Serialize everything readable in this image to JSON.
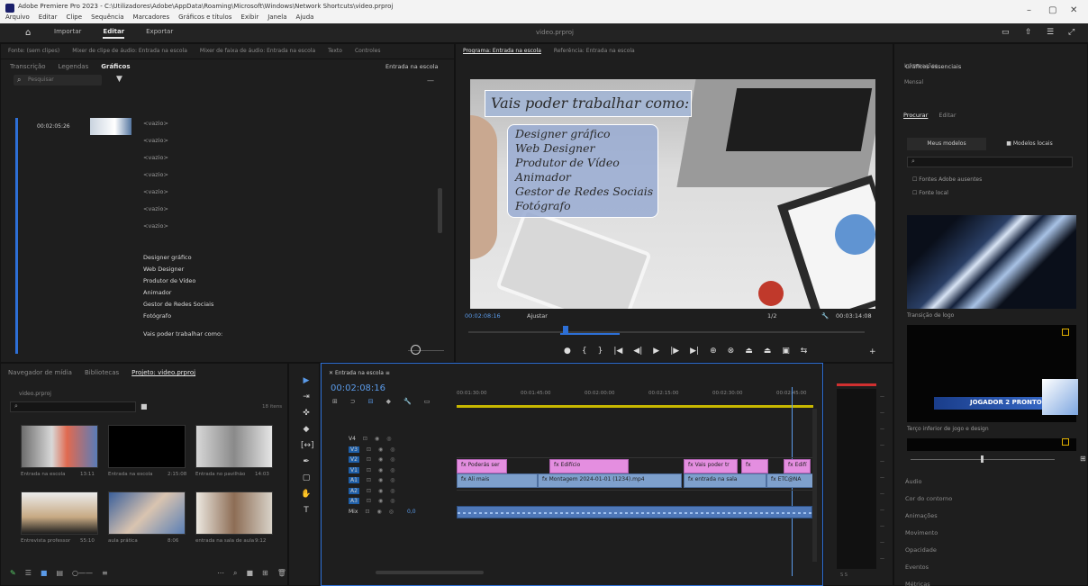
{
  "app": {
    "window_title": "Adobe Premiere Pro 2023 - C:\\Utilizadores\\Adobe\\AppData\\Roaming\\Microsoft\\Windows\\Network Shortcuts\\video.prproj",
    "menu": [
      "Arquivo",
      "Editar",
      "Clipe",
      "Sequência",
      "Marcadores",
      "Gráficos e títulos",
      "Exibir",
      "Janela",
      "Ajuda"
    ],
    "workspace_tabs": [
      "Importar",
      "Editar",
      "Exportar"
    ],
    "active_workspace": "Editar",
    "project_title": "video.prproj"
  },
  "top_left_panel": {
    "header_tabs": [
      "Fonte: (sem clipes)",
      "Mixer de clipe de áudio: Entrada na escola",
      "Mixer de faixa de áudio: Entrada na escola",
      "Texto",
      "Controles"
    ],
    "sub_tabs": [
      "Transcrição",
      "Legendas",
      "Gráficos"
    ],
    "active_sub_tab": "Gráficos",
    "sequence_label": "Entrada na escola",
    "search_placeholder": "Pesquisar",
    "timestamp": "00:02:05:26",
    "blank_items": [
      "<vazio>",
      "<vazio>",
      "<vazio>",
      "<vazio>",
      "<vazio>",
      "<vazio>",
      "<vazio>"
    ],
    "text_layers": [
      "Designer gráfico",
      "Web Designer",
      "Produtor de Vídeo",
      "Animador",
      "Gestor de Redes Sociais",
      "Fotógrafo"
    ],
    "main_layer": "Vais poder trabalhar como:"
  },
  "program_monitor": {
    "header_tabs": [
      "Programa: Entrada na escola",
      "Referência: Entrada na escola"
    ],
    "heading_text": "Vais poder trabalhar como:",
    "list_text": [
      "Designer gráfico",
      "Web Designer",
      "Produtor de Vídeo",
      "Animador",
      "Gestor de Redes Sociais",
      "Fotógrafo"
    ],
    "timecode_left": "00:02:08:16",
    "fit": "Ajustar",
    "quality": "1/2",
    "timecode_right": "00:03:14:08"
  },
  "project_panel": {
    "tabs": [
      "Navegador de mídia",
      "Bibliotecas",
      "Projeto: video.prproj"
    ],
    "active_tab": "Projeto: video.prproj",
    "project_name": "video.prproj",
    "items_count": "18 itens",
    "thumbnails": [
      {
        "label": "Entrada na escola",
        "dur": "13:11"
      },
      {
        "label": "Entrada na escola",
        "dur": "2:15:08"
      },
      {
        "label": "Entrada no pavilhão",
        "dur": "14:03"
      },
      {
        "label": "Entrevista professor",
        "dur": "55:10"
      },
      {
        "label": "aula prática",
        "dur": "8:06"
      },
      {
        "label": "entrada na sala de aula",
        "dur": "9:12"
      }
    ]
  },
  "timeline": {
    "sequence_tab": "Entrada na escola",
    "timecode": "00:02:08:16",
    "ruler": [
      "00:01:30:00",
      "00:01:45:00",
      "00:02:00:00",
      "00:02:15:00",
      "00:02:30:00",
      "00:02:45:00"
    ],
    "tracks": [
      "V4",
      "V3",
      "V2",
      "V1",
      "A1",
      "A2",
      "A3",
      "Mix"
    ],
    "mix_value": "0,0",
    "clips_v2": [
      "fx Poderás ser",
      "fx Edifício",
      "fx Vais poder tr",
      "fx",
      "fx Edifí"
    ],
    "clips_v1": [
      "fx Ali mais",
      "fx  Montagem 2024-01-01 (1234).mp4",
      "fx entrada na sala",
      "fx  ETC@NA"
    ]
  },
  "essential_graphics": {
    "tabs": [
      "Gráficos essenciais"
    ],
    "sub_tabs": [
      "Procurar",
      "Editar"
    ],
    "my_templates": "Meus modelos",
    "local_templates": "Modelos locais",
    "checkbox_1": "Fontes Adobe ausentes",
    "checkbox_2": "Fonte local",
    "template_1": "Transição de logo",
    "template_2": "Terço inferior de jogo e design",
    "template_text": "JOGADOR 2 PRONTO!",
    "props": [
      "Áudio",
      "Cor do contorno",
      "Animações",
      "Movimento",
      "Opacidade",
      "Eventos",
      "Métricas"
    ]
  },
  "statusbar": {}
}
